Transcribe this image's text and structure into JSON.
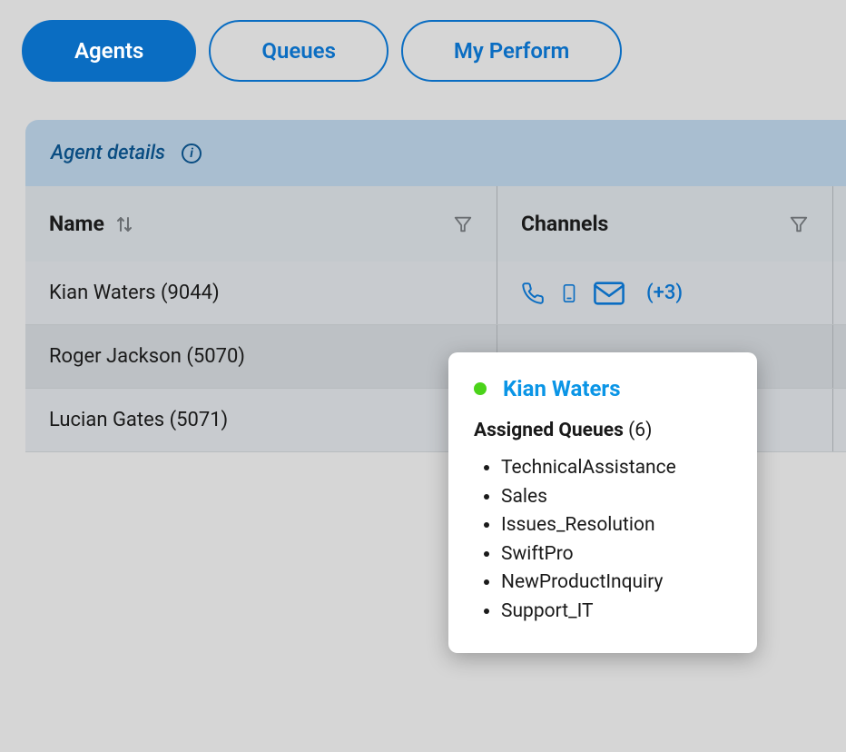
{
  "tabs": {
    "agents": "Agents",
    "queues": "Queues",
    "my_performance": "My Perform"
  },
  "section": {
    "title": "Agent details"
  },
  "columns": {
    "name": "Name",
    "channels": "Channels"
  },
  "rows": [
    {
      "name": "Kian Waters (9044)",
      "more": "(+3)"
    },
    {
      "name": "Roger Jackson (5070)"
    },
    {
      "name": "Lucian Gates (5071)"
    }
  ],
  "popover": {
    "agent": "Kian Waters",
    "subhead_label": "Assigned Queues",
    "subhead_count": "(6)",
    "queues": [
      "TechnicalAssistance",
      "Sales",
      "Issues_Resolution",
      "SwiftPro",
      "NewProductInquiry",
      "Support_IT"
    ]
  }
}
